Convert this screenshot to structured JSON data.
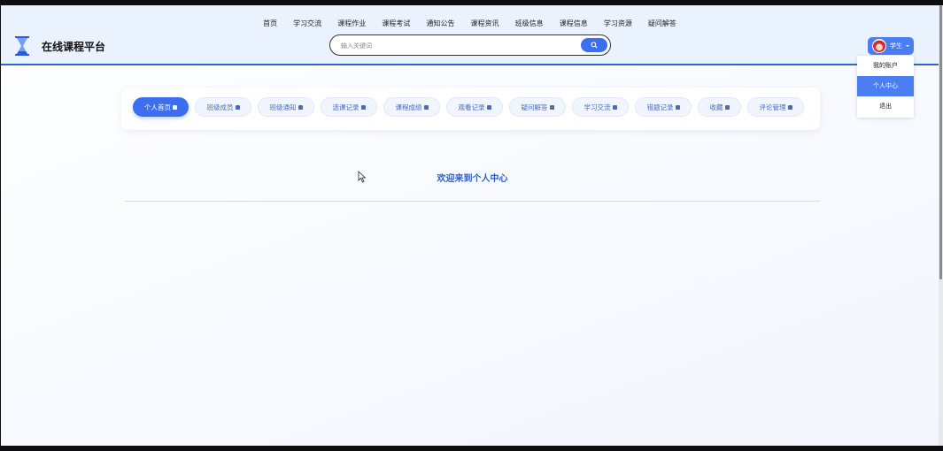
{
  "topnav": [
    "首页",
    "学习交流",
    "课程作业",
    "课程考试",
    "通知公告",
    "课程资讯",
    "班级信息",
    "课程信息",
    "学习资源",
    "疑问解答"
  ],
  "brand": "在线课程平台",
  "search": {
    "placeholder": "输入关键词"
  },
  "user": {
    "label": "学生"
  },
  "dropdown": [
    "我的账户",
    "个人中心",
    "退出"
  ],
  "tabs": [
    "个人首页",
    "班级成员",
    "班级通知",
    "选课记录",
    "课程成绩",
    "观看记录",
    "疑问解答",
    "学习交流",
    "错题记录",
    "收藏",
    "评论管理"
  ],
  "welcome": "欢迎来到个人中心",
  "colors": {
    "accent": "#3b6ff0",
    "header_bg": "#eaf2fd",
    "header_border": "#2f64c9",
    "welcome_text": "#2f5dc8"
  }
}
